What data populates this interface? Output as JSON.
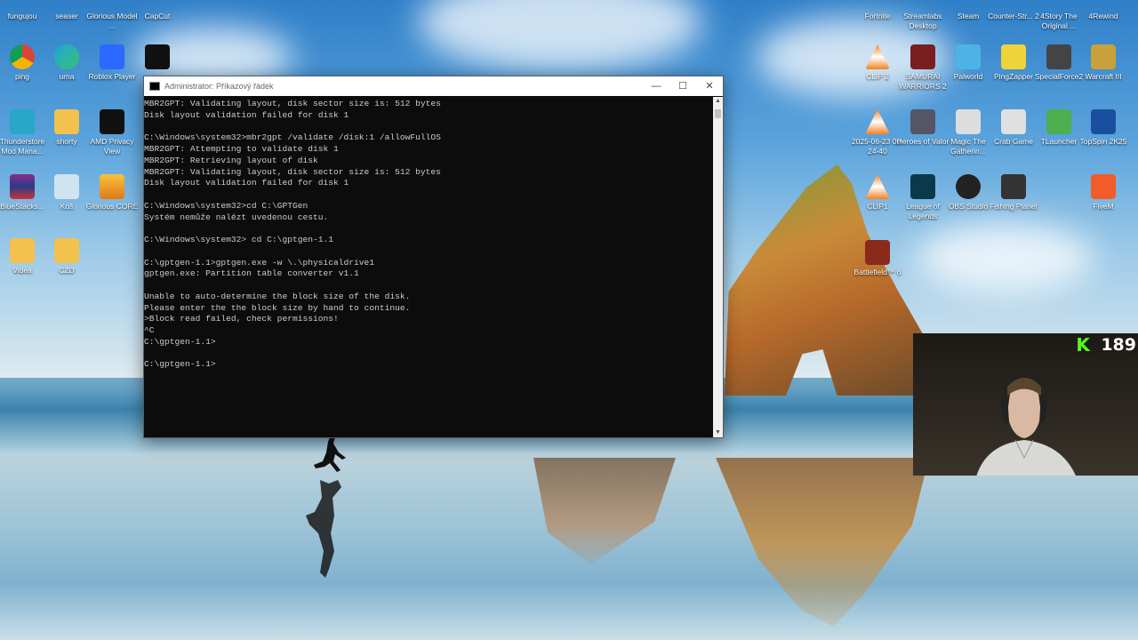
{
  "desktop_left_icons": [
    {
      "label": "fungujou",
      "icon": "folder-icon"
    },
    {
      "label": "seaser",
      "icon": "folder-icon"
    },
    {
      "label": "Glorious Model ...",
      "icon": "app-icon"
    },
    {
      "label": "CapCut",
      "icon": "capcut-icon"
    },
    {
      "label": "ping",
      "icon": "chrome-icon"
    },
    {
      "label": "urna",
      "icon": "edge-icon"
    },
    {
      "label": "Roblox Player",
      "icon": "roblox-icon"
    },
    {
      "label": "",
      "icon": "roblox-studio-icon"
    },
    {
      "label": "Thunderstore Mod Mana...",
      "icon": "thunderstore-icon"
    },
    {
      "label": "shorty",
      "icon": "folder-icon"
    },
    {
      "label": "AMD Privacy View",
      "icon": "amd-icon"
    },
    {
      "label": "BlueStacks...",
      "icon": "winrar-icon"
    },
    {
      "label": "Koš",
      "icon": "recycle-bin-icon"
    },
    {
      "label": "Glorious CORE",
      "icon": "glorious-icon"
    },
    {
      "label": "Videa",
      "icon": "folder-icon"
    },
    {
      "label": "CZD",
      "icon": "folder-icon"
    }
  ],
  "desktop_right_icons": [
    {
      "label": "Fortnite",
      "icon": "fortnite-icon"
    },
    {
      "label": "Streamlabs Desktop",
      "icon": "streamlabs-icon"
    },
    {
      "label": "Steam",
      "icon": "steam-icon"
    },
    {
      "label": "Counter-Str... 2",
      "icon": "cs2-icon"
    },
    {
      "label": "4Story The Original ...",
      "icon": "4story-icon"
    },
    {
      "label": "4Rewind",
      "icon": "4rewind-icon"
    },
    {
      "label": "CLIP 2",
      "icon": "vlc-icon"
    },
    {
      "label": "SAMURAI WARRIORS 2",
      "icon": "samurai-icon"
    },
    {
      "label": "Palworld",
      "icon": "palworld-icon"
    },
    {
      "label": "PingZapper",
      "icon": "pingzapper-icon"
    },
    {
      "label": "SpecialForce2",
      "icon": "specialforce-icon"
    },
    {
      "label": "Warcraft III",
      "icon": "warcraft-icon"
    },
    {
      "label": "2025-06-23 00-24-40",
      "icon": "vlc-icon"
    },
    {
      "label": "Heroes of Valor",
      "icon": "heroes-icon"
    },
    {
      "label": "Magic The Gatherin...",
      "icon": "mtg-icon"
    },
    {
      "label": "Crab Game",
      "icon": "crabgame-icon"
    },
    {
      "label": "TLauncher",
      "icon": "tlauncher-icon"
    },
    {
      "label": "TopSpin 2K25",
      "icon": "topspin-icon"
    },
    {
      "label": "CLIP1",
      "icon": "vlc-icon"
    },
    {
      "label": "League of Legends",
      "icon": "lol-icon"
    },
    {
      "label": "OBS Studio",
      "icon": "obs-icon"
    },
    {
      "label": "Fishing Planet",
      "icon": "fishing-icon"
    },
    {
      "label": "FiveM",
      "icon": "fivem-icon"
    },
    {
      "label": "Battlefield™ 6",
      "icon": "battlefield-icon"
    }
  ],
  "cmd_window": {
    "title": "Administrator: Příkazový řádek",
    "minimize": "—",
    "maximize": "☐",
    "close": "✕",
    "lines": [
      "MBR2GPT: Validating layout, disk sector size is: 512 bytes",
      "Disk layout validation failed for disk 1",
      "",
      "C:\\Windows\\system32>mbr2gpt /validate /disk:1 /allowFullOS",
      "MBR2GPT: Attempting to validate disk 1",
      "MBR2GPT: Retrieving layout of disk",
      "MBR2GPT: Validating layout, disk sector size is: 512 bytes",
      "Disk layout validation failed for disk 1",
      "",
      "C:\\Windows\\system32>cd C:\\GPTGen",
      "Systém nemůže nalézt uvedenou cestu.",
      "",
      "C:\\Windows\\system32> cd C:\\gptgen-1.1",
      "",
      "C:\\gptgen-1.1>gptgen.exe -w \\.\\physicaldrive1",
      "gptgen.exe: Partition table converter v1.1",
      "",
      "Unable to auto-determine the block size of the disk.",
      "Please enter the the block size by hand to continue.",
      ">Block read failed, check permissions!",
      "^C",
      "C:\\gptgen-1.1>",
      "",
      "C:\\gptgen-1.1>"
    ]
  },
  "webcam_overlay": {
    "platform_icon": "kick-icon",
    "platform_glyph": "K",
    "viewer_count": "189",
    "accent_color": "#53fc18"
  }
}
